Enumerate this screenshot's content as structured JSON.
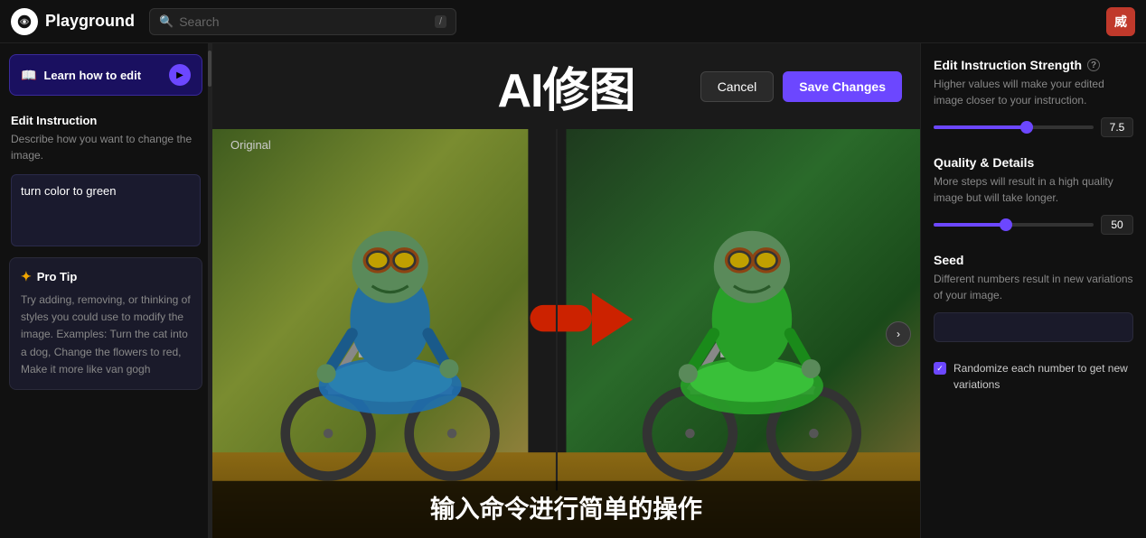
{
  "nav": {
    "logo_text": "Playground",
    "search_placeholder": "Search",
    "search_kbd": "/",
    "avatar_text": "威"
  },
  "sidebar": {
    "learn_btn": "Learn how to edit",
    "play_icon": "▶",
    "edit_instruction_title": "Edit Instruction",
    "edit_instruction_desc": "Describe how you want to change the image.",
    "instruction_value": "turn color to green",
    "pro_tip_title": "Pro Tip",
    "pro_tip_text": "Try adding, removing, or thinking of styles you could use to modify the image. Examples: Turn the cat into a dog, Change the flowers to red, Make it more like van gogh"
  },
  "center": {
    "title": "AI修图",
    "original_label": "Original",
    "cancel_btn": "Cancel",
    "save_btn": "Save Changes",
    "overlay_text": "输入命令进行简单的操作"
  },
  "right_panel": {
    "strength_title": "Edit Instruction Strength",
    "strength_desc": "Higher values will make your edited image closer to your instruction.",
    "strength_value": "7.5",
    "strength_percent": 58,
    "quality_title": "Quality & Details",
    "quality_desc": "More steps will result in a high quality image but will take longer.",
    "quality_value": "50",
    "quality_percent": 45,
    "seed_title": "Seed",
    "seed_desc": "Different numbers result in new variations of your image.",
    "seed_placeholder": "",
    "randomize_label": "Randomize each number to get new variations"
  }
}
